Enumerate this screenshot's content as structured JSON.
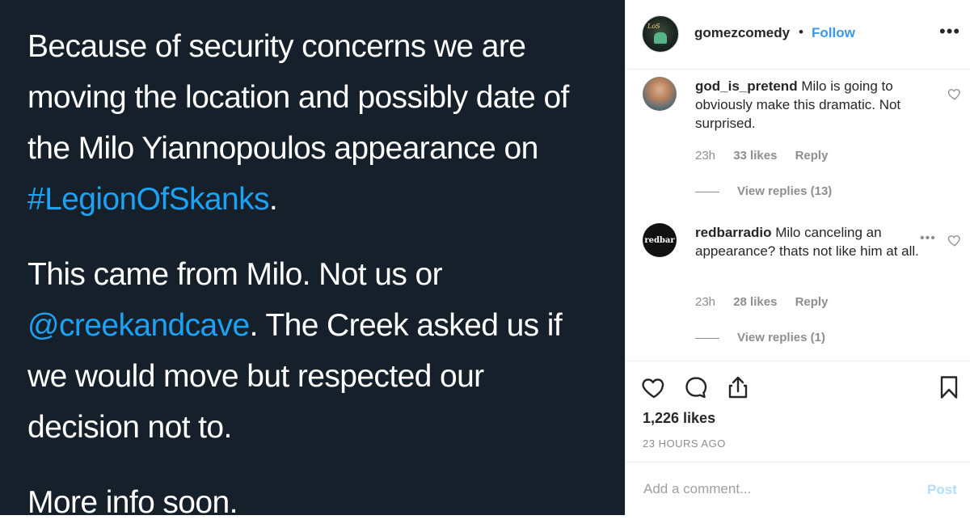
{
  "tweet": {
    "p1_text": "Because of security concerns we are moving the location and possibly date of the Milo Yiannopoulos appearance on ",
    "p1_hashtag": "#LegionOfSkanks",
    "p1_end": ".",
    "p2_text": "This came from Milo. Not us or ",
    "p2_mention": "@creekandcave",
    "p2_end": ". The Creek asked us if we would move but respected our decision not to.",
    "p3_text": "More info soon."
  },
  "header": {
    "username": "gomezcomedy",
    "separator": "•",
    "follow_label": "Follow",
    "more_icon": "more-horizontal-icon"
  },
  "comments": [
    {
      "username": "god_is_pretend",
      "text": "Milo is going to obviously make this dramatic. Not surprised.",
      "time": "23h",
      "likes": "33 likes",
      "reply_label": "Reply",
      "view_replies": "View replies (13)"
    },
    {
      "username": "redbarradio",
      "avatar_text": "redbar",
      "text": "Milo canceling an appearance? thats not like him at all.",
      "time": "23h",
      "likes": "28 likes",
      "reply_label": "Reply",
      "view_replies": "View replies (1)"
    }
  ],
  "actions": {
    "likes_count": "1,226 likes",
    "time_ago": "23 HOURS AGO"
  },
  "add_comment": {
    "placeholder": "Add a comment...",
    "post_label": "Post"
  },
  "colors": {
    "tweet_bg": "#15202b",
    "link_blue": "#1da1f2",
    "follow_blue": "#3897f0",
    "muted_gray": "#8e8e8e"
  }
}
